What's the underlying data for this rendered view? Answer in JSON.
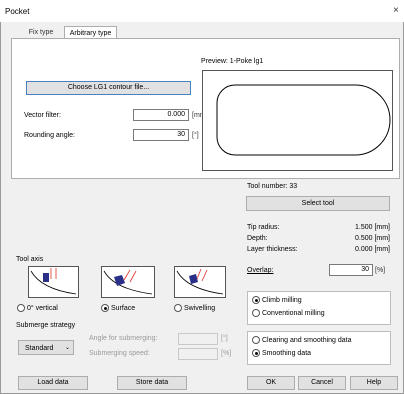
{
  "window": {
    "title": "Pocket",
    "close_glyph": "×"
  },
  "tabs": [
    {
      "label": "Fix type"
    },
    {
      "label": "Arbitrary type",
      "active": true
    }
  ],
  "arbitrary": {
    "choose_button": "Choose LG1 contour file...",
    "vector_filter": {
      "label": "Vector filter:",
      "value": "0.000",
      "unit": "[mm]"
    },
    "rounding_angle": {
      "label": "Rounding angle:",
      "value": "30",
      "unit": "[°]"
    },
    "preview_label": "Preview: 1-Poke lg1"
  },
  "tool": {
    "number_label": "Tool number: 33",
    "select_button": "Select tool",
    "rows": [
      {
        "label": "Tip radius:",
        "value": "1.500 [mm]"
      },
      {
        "label": "Depth:",
        "value": "0.500 [mm]"
      },
      {
        "label": "Layer thickness:",
        "value": "0.000 [mm]"
      }
    ],
    "overlap": {
      "label": "Overlap:",
      "value": "30",
      "unit": "[%]"
    }
  },
  "tool_axis": {
    "label": "Tool axis",
    "options": [
      {
        "label": "0° vertical",
        "selected": false
      },
      {
        "label": "Surface",
        "selected": true
      },
      {
        "label": "Swivelling",
        "selected": false
      }
    ]
  },
  "milling": {
    "options": [
      {
        "label": "Climb milling",
        "selected": true
      },
      {
        "label": "Conventional milling",
        "selected": false
      }
    ]
  },
  "submerge": {
    "label": "Submerge strategy",
    "select_value": "Standard",
    "angle": {
      "label": "Angle for submerging:",
      "unit": "[°]"
    },
    "speed": {
      "label": "Submerging speed:",
      "unit": "[%]"
    }
  },
  "data_mode": {
    "options": [
      {
        "label": "Clearing and smoothing data",
        "selected": false
      },
      {
        "label": "Smoothing data",
        "selected": true
      }
    ]
  },
  "footer": {
    "load": "Load data",
    "store": "Store data",
    "ok": "OK",
    "cancel": "Cancel",
    "help": "Help"
  },
  "colors": {
    "accent": "#4a7fc0",
    "tool_head": "#2a2f8a",
    "arrow": "#e0302a"
  }
}
